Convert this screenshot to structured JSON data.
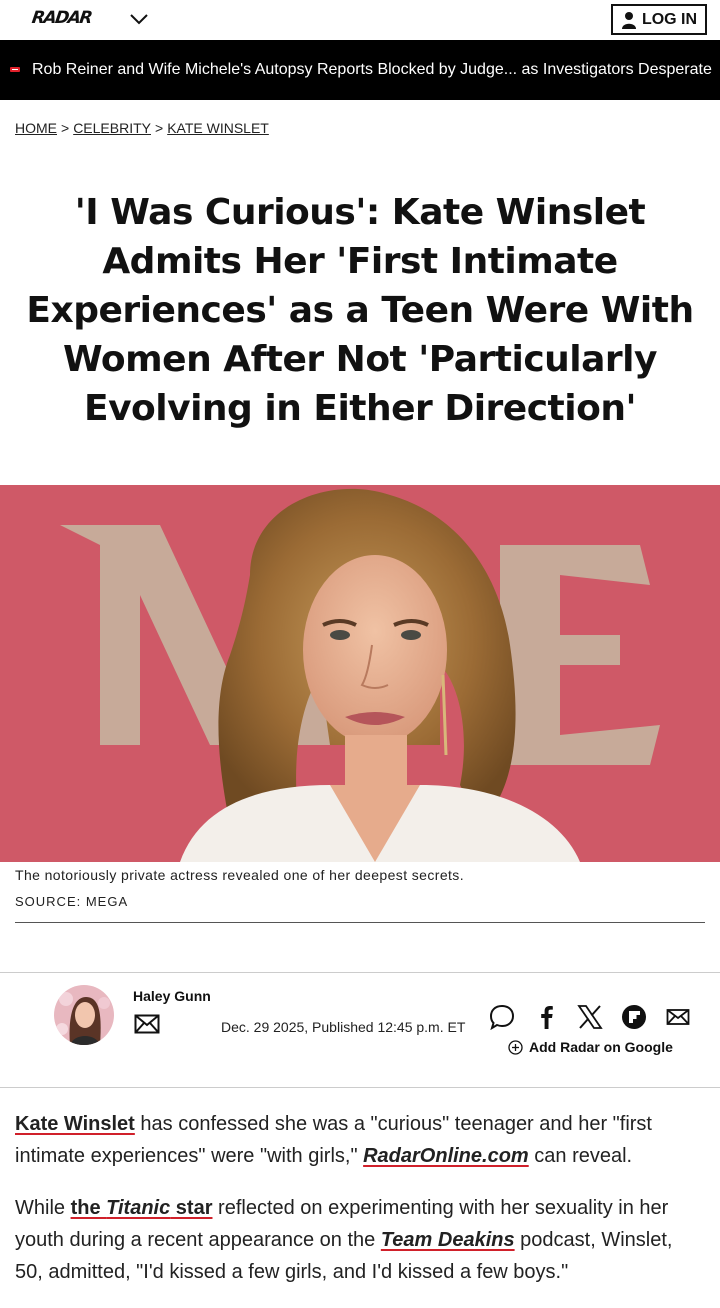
{
  "header": {
    "logo": "RADAR",
    "login_label": "LOG IN"
  },
  "ticker": {
    "text": "Rob Reiner and Wife Michele's Autopsy Reports Blocked by Judge... as Investigators Desperate"
  },
  "breadcrumb": {
    "home": "HOME",
    "section": "CELEBRITY",
    "topic": "KATE WINSLET",
    "separator": ">"
  },
  "article": {
    "title": "'I Was Curious': Kate Winslet Admits Her 'First Intimate Experiences' as a Teen Were With Women After Not 'Particularly Evolving in Either Direction'",
    "caption": "The notoriously private actress revealed one of her deepest secrets.",
    "source": "SOURCE: MEGA",
    "author": "Haley Gunn",
    "date": "Dec. 29 2025, Published 12:45 p.m. ET",
    "add_google": "Add Radar on Google",
    "p1": {
      "link1": "Kate Winslet",
      "t1": " has confessed she was a \"curious\" teenager and her \"first intimate experiences\" were \"with girls,\" ",
      "link2": "RadarOnline.com",
      "t2": " can reveal."
    },
    "p2": {
      "t0": "While ",
      "link1a": "the ",
      "link1b": "Titanic",
      "link1c": " star",
      "t1": " reflected on experimenting with her sexuality in her youth during a recent appearance on the ",
      "link2": "Team Deakins",
      "t2": " podcast, Winslet, 50, admitted, \"I'd kissed a few girls, and I'd kissed a few boys.\""
    }
  },
  "colors": {
    "accent": "#d0202a",
    "ticker_bg": "#000000",
    "hero_bg": "#cf5967"
  }
}
